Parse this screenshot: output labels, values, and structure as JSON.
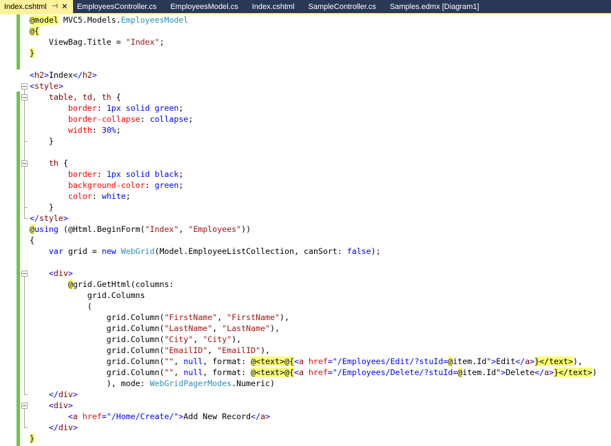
{
  "tabs": [
    {
      "label": "Index.cshtml",
      "active": true
    },
    {
      "label": "EmployeesController.cs",
      "active": false
    },
    {
      "label": "EmployeesModel.cs",
      "active": false
    },
    {
      "label": "Index.cshtml",
      "active": false
    },
    {
      "label": "SampleController.cs",
      "active": false
    },
    {
      "label": "Samples.edmx [Diagram1]",
      "active": false
    }
  ],
  "tab_icons": {
    "pin": "pin-icon",
    "close": "close-icon"
  },
  "colors": {
    "tab_bar": "#293955",
    "active_tab": "#fff29d",
    "razor_highlight": "#ffff7a",
    "keyword": "#0000ff",
    "type": "#2b91af",
    "string": "#a31515",
    "html_tag": "#800000",
    "html_attribute": "#ff0000",
    "change_bar": "#6cc644"
  },
  "code_lines": [
    [
      {
        "c": "ra",
        "t": "@model"
      },
      {
        "c": "tx",
        "t": " MVC5.Models."
      },
      {
        "c": "ty",
        "t": "EmployeesModel"
      }
    ],
    [
      {
        "c": "ra",
        "t": "@{"
      }
    ],
    [
      {
        "c": "tx",
        "t": "    ViewBag.Title = "
      },
      {
        "c": "st",
        "t": "\"Index\""
      },
      {
        "c": "tx",
        "t": ";"
      }
    ],
    [
      {
        "c": "ra",
        "t": "}"
      }
    ],
    [],
    [
      {
        "c": "kw",
        "t": "<"
      },
      {
        "c": "tg",
        "t": "h2"
      },
      {
        "c": "kw",
        "t": ">"
      },
      {
        "c": "tx",
        "t": "Index"
      },
      {
        "c": "kw",
        "t": "</"
      },
      {
        "c": "tg",
        "t": "h2"
      },
      {
        "c": "kw",
        "t": ">"
      }
    ],
    [
      {
        "c": "kw",
        "t": "<"
      },
      {
        "c": "tg",
        "t": "style"
      },
      {
        "c": "kw",
        "t": ">"
      }
    ],
    [
      {
        "c": "tg",
        "t": "    table, td, th "
      },
      {
        "c": "tx",
        "t": "{"
      }
    ],
    [
      {
        "c": "at",
        "t": "        border"
      },
      {
        "c": "tx",
        "t": ": "
      },
      {
        "c": "pv",
        "t": "1px solid green"
      },
      {
        "c": "tx",
        "t": ";"
      }
    ],
    [
      {
        "c": "at",
        "t": "        border-collapse"
      },
      {
        "c": "tx",
        "t": ": "
      },
      {
        "c": "pv",
        "t": "collapse"
      },
      {
        "c": "tx",
        "t": ";"
      }
    ],
    [
      {
        "c": "at",
        "t": "        width"
      },
      {
        "c": "tx",
        "t": ": "
      },
      {
        "c": "pv",
        "t": "30%"
      },
      {
        "c": "tx",
        "t": ";"
      }
    ],
    [
      {
        "c": "tx",
        "t": "    }"
      }
    ],
    [],
    [
      {
        "c": "tg",
        "t": "    th "
      },
      {
        "c": "tx",
        "t": "{"
      }
    ],
    [
      {
        "c": "at",
        "t": "        border"
      },
      {
        "c": "tx",
        "t": ": "
      },
      {
        "c": "pv",
        "t": "1px solid black"
      },
      {
        "c": "tx",
        "t": ";"
      }
    ],
    [
      {
        "c": "at",
        "t": "        background-color"
      },
      {
        "c": "tx",
        "t": ": "
      },
      {
        "c": "pv",
        "t": "green"
      },
      {
        "c": "tx",
        "t": ";"
      }
    ],
    [
      {
        "c": "at",
        "t": "        color"
      },
      {
        "c": "tx",
        "t": ": "
      },
      {
        "c": "pv",
        "t": "white"
      },
      {
        "c": "tx",
        "t": ";"
      }
    ],
    [
      {
        "c": "tx",
        "t": "    }"
      }
    ],
    [
      {
        "c": "kw",
        "t": "</"
      },
      {
        "c": "tg",
        "t": "style"
      },
      {
        "c": "kw",
        "t": ">"
      }
    ],
    [
      {
        "c": "ra",
        "t": "@"
      },
      {
        "c": "kw",
        "t": "using"
      },
      {
        "c": "tx",
        "t": " (@Html.BeginForm("
      },
      {
        "c": "st",
        "t": "\"Index\""
      },
      {
        "c": "tx",
        "t": ", "
      },
      {
        "c": "st",
        "t": "\"Employees\""
      },
      {
        "c": "tx",
        "t": "))"
      }
    ],
    [
      {
        "c": "tx",
        "t": "{"
      }
    ],
    [
      {
        "c": "kw",
        "t": "    var"
      },
      {
        "c": "tx",
        "t": " grid = "
      },
      {
        "c": "kw",
        "t": "new"
      },
      {
        "c": "tx",
        "t": " "
      },
      {
        "c": "ty",
        "t": "WebGrid"
      },
      {
        "c": "tx",
        "t": "(Model.EmployeeListCollection, canSort: "
      },
      {
        "c": "kw",
        "t": "false"
      },
      {
        "c": "tx",
        "t": ");"
      }
    ],
    [],
    [
      {
        "c": "kw",
        "t": "    <"
      },
      {
        "c": "tg",
        "t": "div"
      },
      {
        "c": "kw",
        "t": ">"
      }
    ],
    [
      {
        "c": "tx",
        "t": "        "
      },
      {
        "c": "ra",
        "t": "@"
      },
      {
        "c": "tx",
        "t": "grid.GetHtml(columns:"
      }
    ],
    [
      {
        "c": "tx",
        "t": "            grid.Columns"
      }
    ],
    [
      {
        "c": "tx",
        "t": "            ("
      }
    ],
    [
      {
        "c": "tx",
        "t": "                grid.Column("
      },
      {
        "c": "st",
        "t": "\"FirstName\""
      },
      {
        "c": "tx",
        "t": ", "
      },
      {
        "c": "st",
        "t": "\"FirstName\""
      },
      {
        "c": "tx",
        "t": "),"
      }
    ],
    [
      {
        "c": "tx",
        "t": "                grid.Column("
      },
      {
        "c": "st",
        "t": "\"LastName\""
      },
      {
        "c": "tx",
        "t": ", "
      },
      {
        "c": "st",
        "t": "\"LastName\""
      },
      {
        "c": "tx",
        "t": "),"
      }
    ],
    [
      {
        "c": "tx",
        "t": "                grid.Column("
      },
      {
        "c": "st",
        "t": "\"City\""
      },
      {
        "c": "tx",
        "t": ", "
      },
      {
        "c": "st",
        "t": "\"City\""
      },
      {
        "c": "tx",
        "t": "),"
      }
    ],
    [
      {
        "c": "tx",
        "t": "                grid.Column("
      },
      {
        "c": "st",
        "t": "\"EmailID\""
      },
      {
        "c": "tx",
        "t": ", "
      },
      {
        "c": "st",
        "t": "\"EmailID\""
      },
      {
        "c": "tx",
        "t": "),"
      }
    ],
    [
      {
        "c": "tx",
        "t": "                grid.Column("
      },
      {
        "c": "st",
        "t": "\"\""
      },
      {
        "c": "tx",
        "t": ", "
      },
      {
        "c": "kw",
        "t": "null"
      },
      {
        "c": "tx",
        "t": ", format: "
      },
      {
        "c": "ra",
        "t": "@<text>@{"
      },
      {
        "c": "kw",
        "t": "<"
      },
      {
        "c": "tg",
        "t": "a"
      },
      {
        "c": "at",
        "t": " href"
      },
      {
        "c": "kw",
        "t": "=\"/Employees/Edit/?stuId="
      },
      {
        "c": "ra",
        "t": "@"
      },
      {
        "c": "tx",
        "t": "item.Id"
      },
      {
        "c": "kw",
        "t": "\">"
      },
      {
        "c": "tx",
        "t": "Edit"
      },
      {
        "c": "kw",
        "t": "</"
      },
      {
        "c": "tg",
        "t": "a"
      },
      {
        "c": "kw",
        "t": ">"
      },
      {
        "c": "ra",
        "t": "}</text>"
      },
      {
        "c": "tx",
        "t": "),"
      }
    ],
    [
      {
        "c": "tx",
        "t": "                grid.Column("
      },
      {
        "c": "st",
        "t": "\"\""
      },
      {
        "c": "tx",
        "t": ", "
      },
      {
        "c": "kw",
        "t": "null"
      },
      {
        "c": "tx",
        "t": ", format: "
      },
      {
        "c": "ra",
        "t": "@<text>@{"
      },
      {
        "c": "kw",
        "t": "<"
      },
      {
        "c": "tg",
        "t": "a"
      },
      {
        "c": "at",
        "t": " href"
      },
      {
        "c": "kw",
        "t": "=\"/Employees/Delete/?stuId="
      },
      {
        "c": "ra",
        "t": "@"
      },
      {
        "c": "tx",
        "t": "item.Id"
      },
      {
        "c": "kw",
        "t": "\">"
      },
      {
        "c": "tx",
        "t": "Delete"
      },
      {
        "c": "kw",
        "t": "</"
      },
      {
        "c": "tg",
        "t": "a"
      },
      {
        "c": "kw",
        "t": ">"
      },
      {
        "c": "ra",
        "t": "}</text>"
      },
      {
        "c": "tx",
        "t": ")"
      }
    ],
    [
      {
        "c": "tx",
        "t": "                ), mode: "
      },
      {
        "c": "ty",
        "t": "WebGridPagerModes"
      },
      {
        "c": "tx",
        "t": ".Numeric)"
      }
    ],
    [
      {
        "c": "kw",
        "t": "    </"
      },
      {
        "c": "tg",
        "t": "div"
      },
      {
        "c": "kw",
        "t": ">"
      }
    ],
    [
      {
        "c": "kw",
        "t": "    <"
      },
      {
        "c": "tg",
        "t": "div"
      },
      {
        "c": "kw",
        "t": ">"
      }
    ],
    [
      {
        "c": "kw",
        "t": "        <"
      },
      {
        "c": "tg",
        "t": "a"
      },
      {
        "c": "at",
        "t": " href"
      },
      {
        "c": "kw",
        "t": "=\"/Home/Create/\">"
      },
      {
        "c": "tx",
        "t": "Add New Record"
      },
      {
        "c": "kw",
        "t": "</"
      },
      {
        "c": "tg",
        "t": "a"
      },
      {
        "c": "kw",
        "t": ">"
      }
    ],
    [
      {
        "c": "kw",
        "t": "    </"
      },
      {
        "c": "tg",
        "t": "div"
      },
      {
        "c": "kw",
        "t": ">"
      }
    ],
    [
      {
        "c": "ra",
        "t": "}"
      }
    ]
  ],
  "change_bars": [
    [
      0,
      4
    ],
    [
      7,
      39
    ]
  ],
  "fold_regions": [
    [
      6,
      18
    ],
    [
      7,
      11
    ],
    [
      13,
      17
    ],
    [
      23,
      34
    ],
    [
      35,
      37
    ]
  ]
}
